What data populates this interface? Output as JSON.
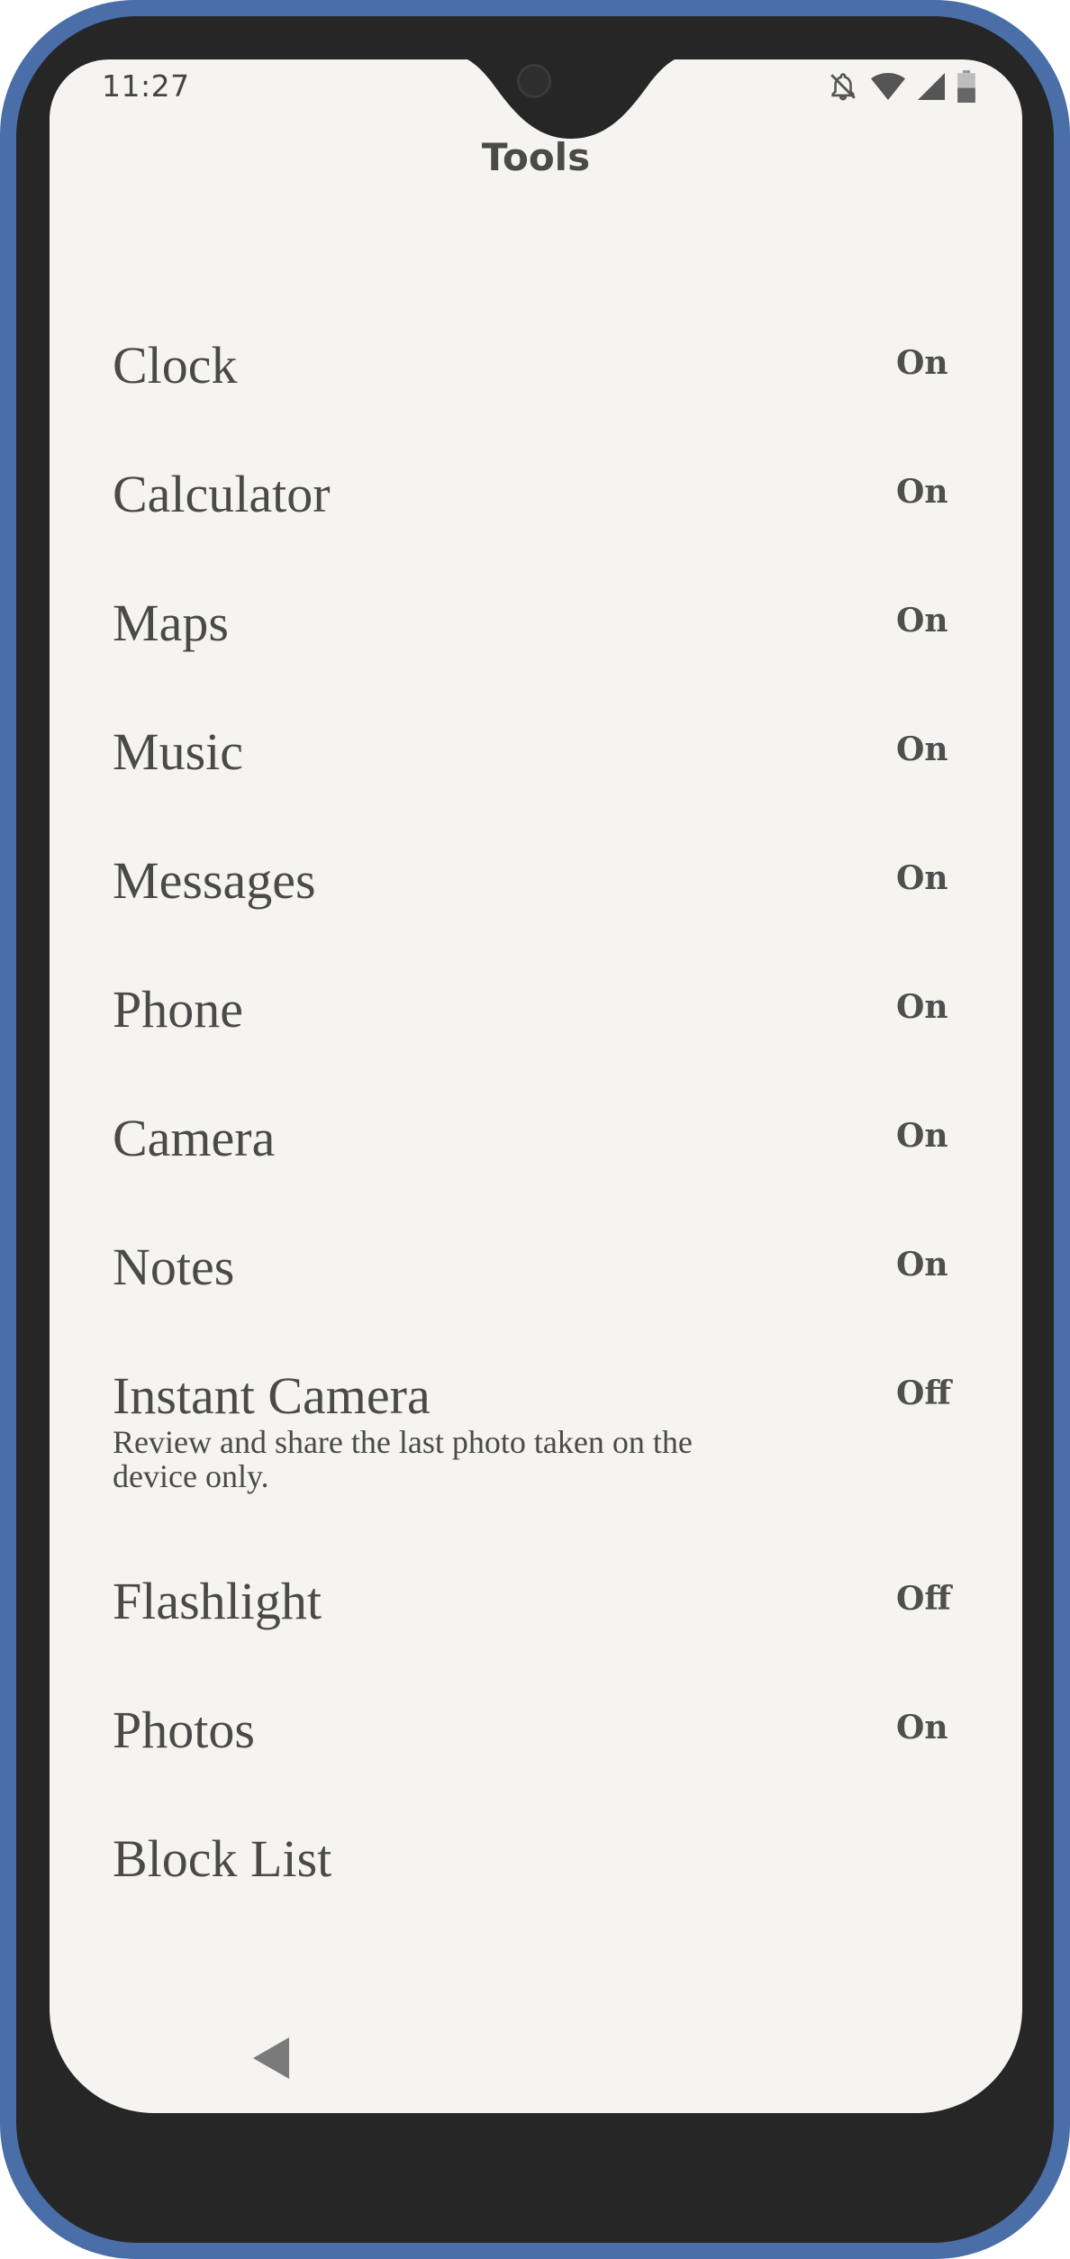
{
  "status_bar": {
    "time": "11:27",
    "icons": [
      "notifications-off-icon",
      "wifi-icon",
      "signal-icon",
      "battery-icon"
    ]
  },
  "header": {
    "title": "Tools"
  },
  "tools": [
    {
      "label": "Clock",
      "state": "On"
    },
    {
      "label": "Calculator",
      "state": "On"
    },
    {
      "label": "Maps",
      "state": "On"
    },
    {
      "label": "Music",
      "state": "On"
    },
    {
      "label": "Messages",
      "state": "On"
    },
    {
      "label": "Phone",
      "state": "On"
    },
    {
      "label": "Camera",
      "state": "On"
    },
    {
      "label": "Notes",
      "state": "On"
    },
    {
      "label": "Instant Camera",
      "state": "Off",
      "description": "Review and share the last photo taken on the device only."
    },
    {
      "label": "Flashlight",
      "state": "Off"
    },
    {
      "label": "Photos",
      "state": "On"
    },
    {
      "label": "Block List"
    }
  ],
  "navigation": {
    "back_icon": "back-triangle-icon"
  },
  "colors": {
    "frame": "#4a6ea8",
    "bezel": "#262626",
    "screen_background": "#f5f4f1",
    "text": "#4a4a4a"
  }
}
